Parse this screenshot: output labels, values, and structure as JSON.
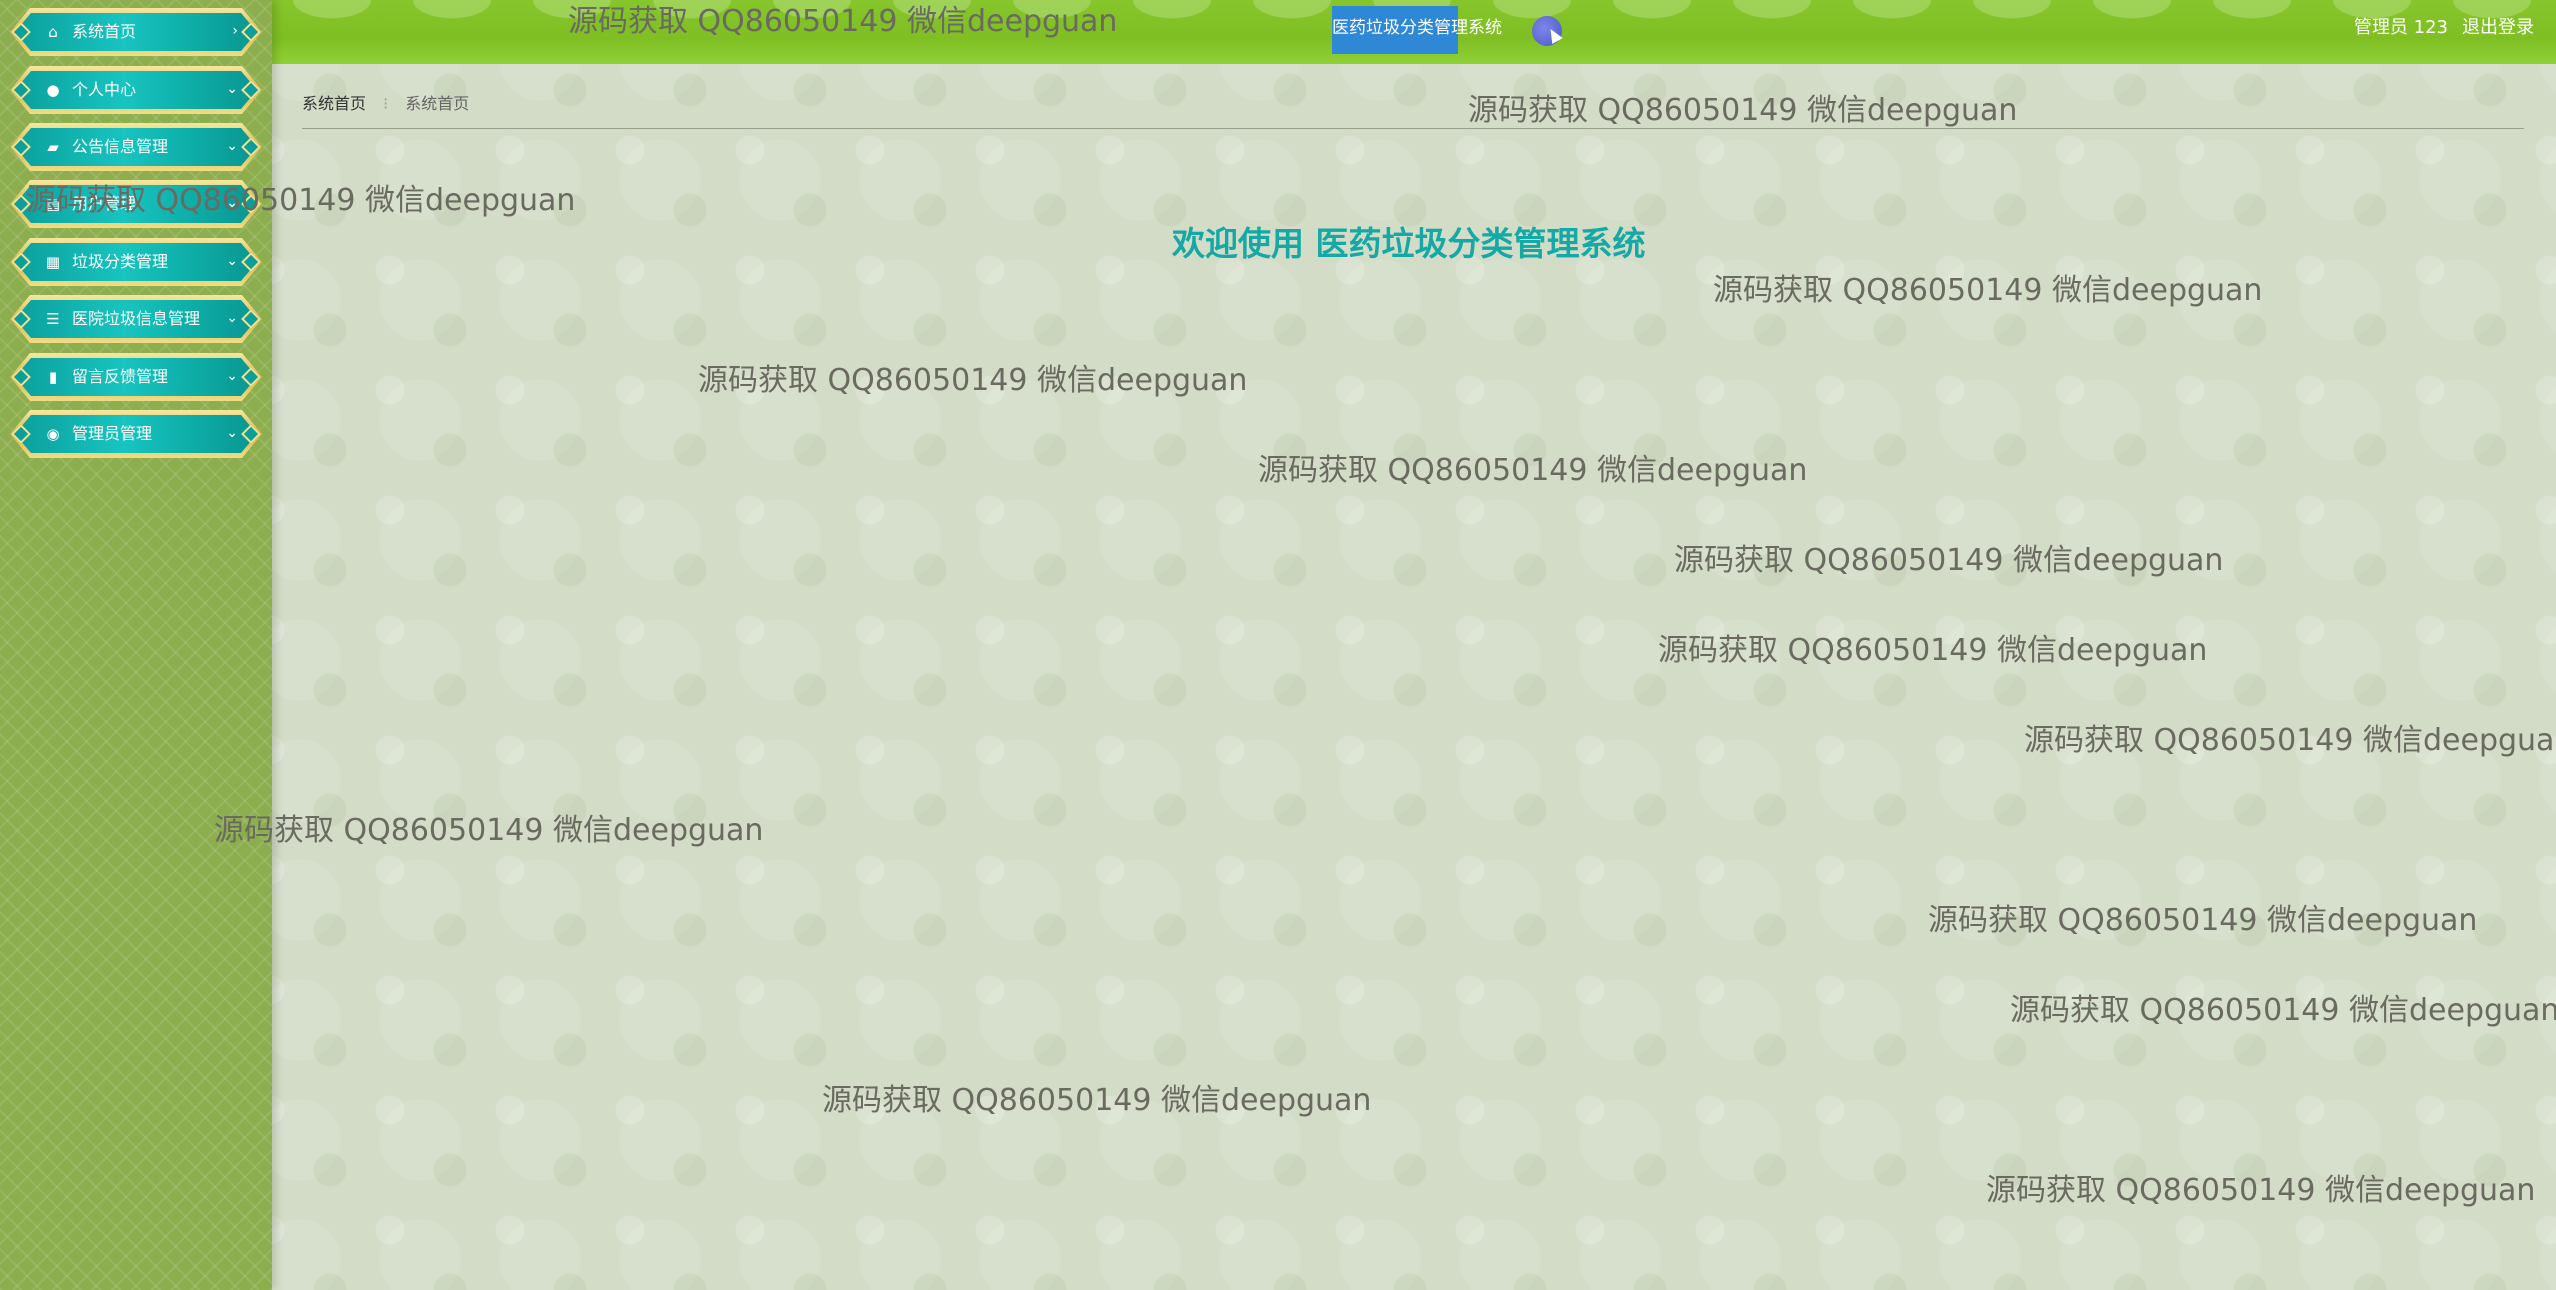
{
  "sidebar": {
    "items": [
      {
        "label": "系统首页",
        "icon": "home-icon",
        "glyph": "⌂",
        "chevron": "›"
      },
      {
        "label": "个人中心",
        "icon": "user-icon",
        "glyph": "●",
        "chevron": "⌄"
      },
      {
        "label": "公告信息管理",
        "icon": "briefcase-icon",
        "glyph": "▰",
        "chevron": "⌄"
      },
      {
        "label": "用户管理",
        "icon": "users-icon",
        "glyph": "▤",
        "chevron": "⌄"
      },
      {
        "label": "垃圾分类管理",
        "icon": "grid-icon",
        "glyph": "▦",
        "chevron": "⌄"
      },
      {
        "label": "医院垃圾信息管理",
        "icon": "list-icon",
        "glyph": "☰",
        "chevron": "⌄"
      },
      {
        "label": "留言反馈管理",
        "icon": "bar-chart-icon",
        "glyph": "▮",
        "chevron": "⌄"
      },
      {
        "label": "管理员管理",
        "icon": "location-icon",
        "glyph": "◉",
        "chevron": "⌄"
      }
    ]
  },
  "header": {
    "system_title": "医药垃圾分类管理系统",
    "admin_label": "管理员 123",
    "logout_label": "退出登录",
    "accent_color": "#2f88d6",
    "theme_dot_color": "#5a64d6"
  },
  "breadcrumb": {
    "home": "系统首页",
    "separator": "⁝",
    "current": "系统首页"
  },
  "main": {
    "welcome": "欢迎使用 医药垃圾分类管理系统"
  },
  "watermark": {
    "text": "源码获取 QQ86050149 微信deepguan"
  }
}
